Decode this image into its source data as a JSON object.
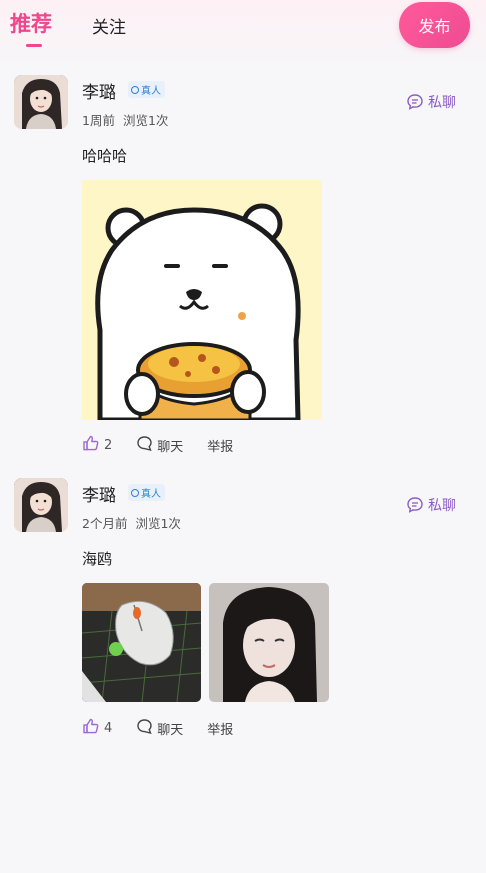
{
  "header": {
    "tabs": [
      {
        "label": "推荐",
        "active": true
      },
      {
        "label": "关注",
        "active": false
      }
    ],
    "publish_label": "发布",
    "accent_color": "#f0468d"
  },
  "posts": [
    {
      "username": "李璐",
      "verified_label": "真人",
      "time": "1周前",
      "views": "浏览1次",
      "chat_label": "私聊",
      "content": "哈哈哈",
      "images": [
        "bear-eating-egg-tart"
      ],
      "likes": "2",
      "comment_label": "聊天",
      "report_label": "举报"
    },
    {
      "username": "李璐",
      "verified_label": "真人",
      "time": "2个月前",
      "views": "浏览1次",
      "chat_label": "私聊",
      "content": "海鸥",
      "images": [
        "computer-mouse-on-mat",
        "girl-portrait"
      ],
      "likes": "4",
      "comment_label": "聊天",
      "report_label": "举报"
    }
  ],
  "icons": {
    "like": "thumbs-up-icon",
    "comment": "chat-bubble-icon",
    "private_chat": "message-icon",
    "verified": "verified-badge-icon"
  }
}
